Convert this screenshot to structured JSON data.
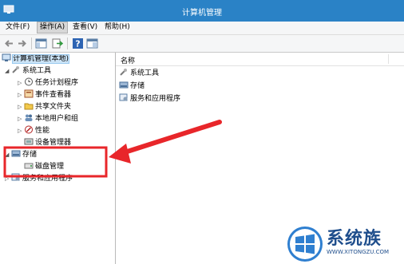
{
  "window": {
    "title": "计算机管理"
  },
  "menu": [
    "文件(F)",
    "操作(A)",
    "查看(V)",
    "帮助(H)"
  ],
  "toolbar": {
    "icons": [
      "back-arrow-icon",
      "forward-arrow-icon",
      "console-tree-icon",
      "export-icon",
      "help-icon",
      "properties-icon"
    ]
  },
  "tree": {
    "root": "计算机管理(本地)",
    "system_tools": "系统工具",
    "task_scheduler": "任务计划程序",
    "event_viewer": "事件查看器",
    "shared_folders": "共享文件夹",
    "local_users": "本地用户和组",
    "performance": "性能",
    "device_manager": "设备管理器",
    "storage": "存储",
    "disk_management": "磁盘管理",
    "services": "服务和应用程序"
  },
  "list": {
    "column": "名称",
    "items": [
      "系统工具",
      "存储",
      "服务和应用程序"
    ]
  },
  "watermark": {
    "name": "系统族",
    "url": "WWW.XITONGZU.COM"
  },
  "colors": {
    "titlebar": "#2a82c6",
    "annotation": "#e8262a",
    "selection": "#cce4f7"
  }
}
